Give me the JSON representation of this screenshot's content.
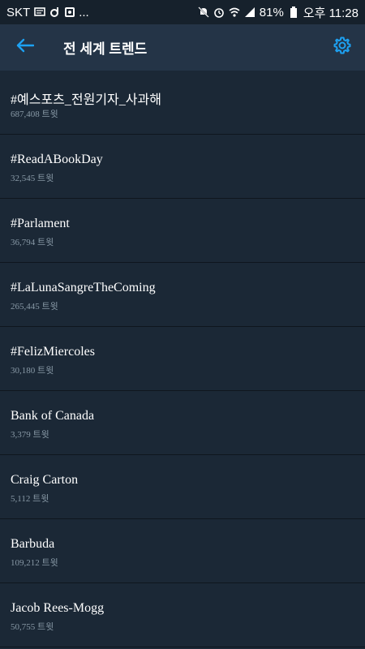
{
  "status_bar": {
    "carrier": "SKT",
    "dots": "...",
    "battery": "81%",
    "time": "오후 11:28"
  },
  "header": {
    "title": "전 세계 트렌드",
    "back_icon": "arrow-left-icon",
    "settings_icon": "gear-icon"
  },
  "colors": {
    "accent": "#1da1f2",
    "background": "#1b2836",
    "header": "#243447",
    "secondary_text": "#8899a6"
  },
  "trends": [
    {
      "name": "#예스포츠_전원기자_사과해",
      "count": "687,408 트윗"
    },
    {
      "name": "#ReadABookDay",
      "count": "32,545 트윗"
    },
    {
      "name": "#Parlament",
      "count": "36,794 트윗"
    },
    {
      "name": "#LaLunaSangreTheComing",
      "count": "265,445 트윗"
    },
    {
      "name": "#FelizMiercoles",
      "count": "30,180 트윗"
    },
    {
      "name": "Bank of Canada",
      "count": "3,379 트윗"
    },
    {
      "name": "Craig Carton",
      "count": "5,112 트윗"
    },
    {
      "name": "Barbuda",
      "count": "109,212 트윗"
    },
    {
      "name": "Jacob Rees-Mogg",
      "count": "50,755 트윗"
    }
  ]
}
